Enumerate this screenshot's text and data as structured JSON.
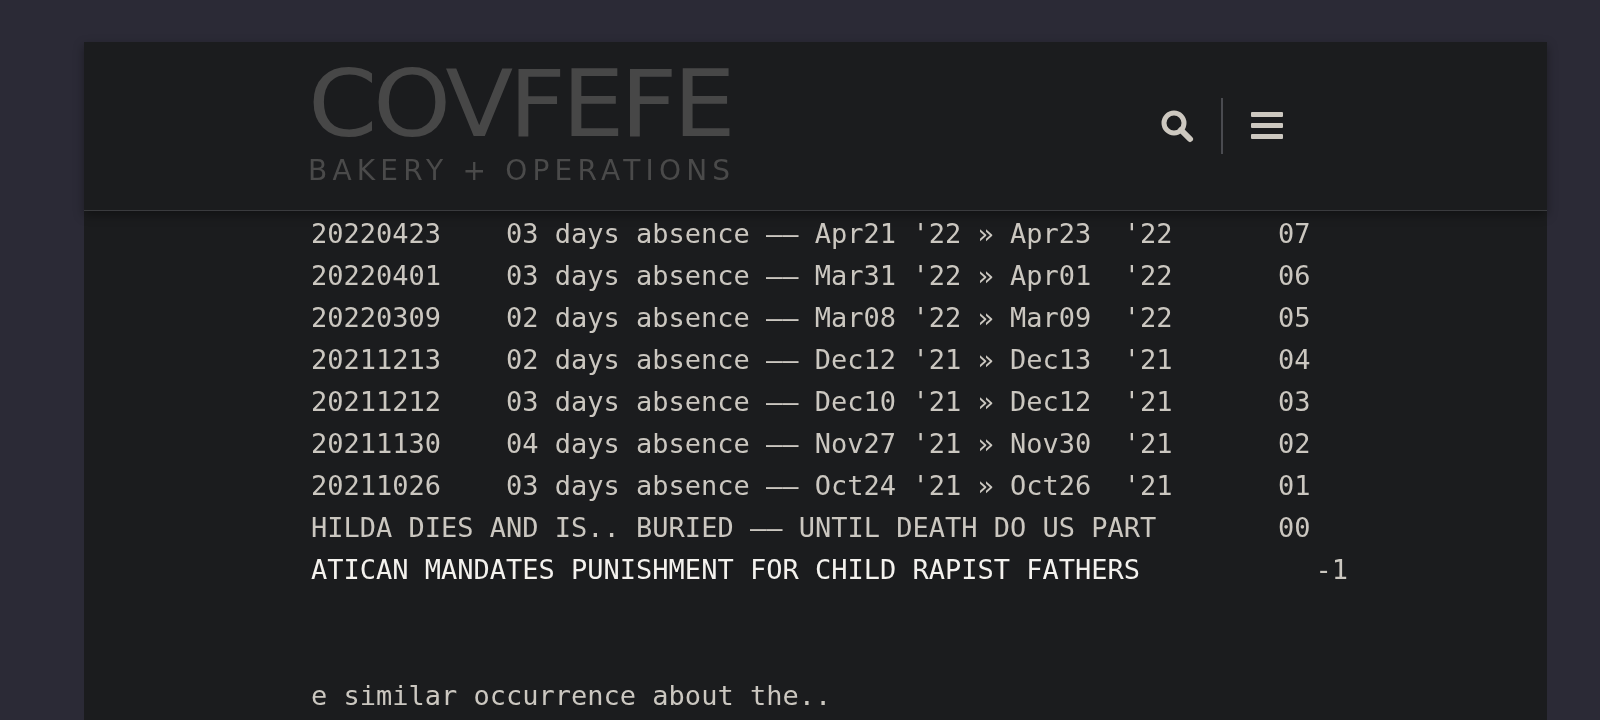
{
  "header": {
    "logo_title": "COVFEFE",
    "logo_subtitle": "BAKERY + OPERATIONS"
  },
  "log": {
    "rows": [
      {
        "kind": "entry",
        "code": "20220423",
        "description": "03 days absence —— Apr21 '22 » Apr23  '22",
        "number": "07"
      },
      {
        "kind": "entry",
        "code": "20220401",
        "description": "03 days absence —— Mar31 '22 » Apr01  '22",
        "number": "06"
      },
      {
        "kind": "entry",
        "code": "20220309",
        "description": "02 days absence —— Mar08 '22 » Mar09  '22",
        "number": "05"
      },
      {
        "kind": "entry",
        "code": "20211213",
        "description": "02 days absence —— Dec12 '21 » Dec13  '21",
        "number": "04"
      },
      {
        "kind": "entry",
        "code": "20211212",
        "description": "03 days absence —— Dec10 '21 » Dec12  '21",
        "number": "03"
      },
      {
        "kind": "entry",
        "code": "20211130",
        "description": "04 days absence —— Nov27 '21 » Nov30  '21",
        "number": "02"
      },
      {
        "kind": "entry",
        "code": "20211026",
        "description": "03 days absence —— Oct24 '21 » Oct26  '21",
        "number": "01"
      },
      {
        "kind": "headline",
        "description": "HILDA DIES AND IS.. BURIED —— UNTIL DEATH DO US PART",
        "number": "00"
      },
      {
        "kind": "alert",
        "description": "ATICAN MANDATES PUNISHMENT FOR CHILD RAPIST FATHERS",
        "number": "-1"
      }
    ],
    "footer_text": "e similar occurrence about the.."
  }
}
